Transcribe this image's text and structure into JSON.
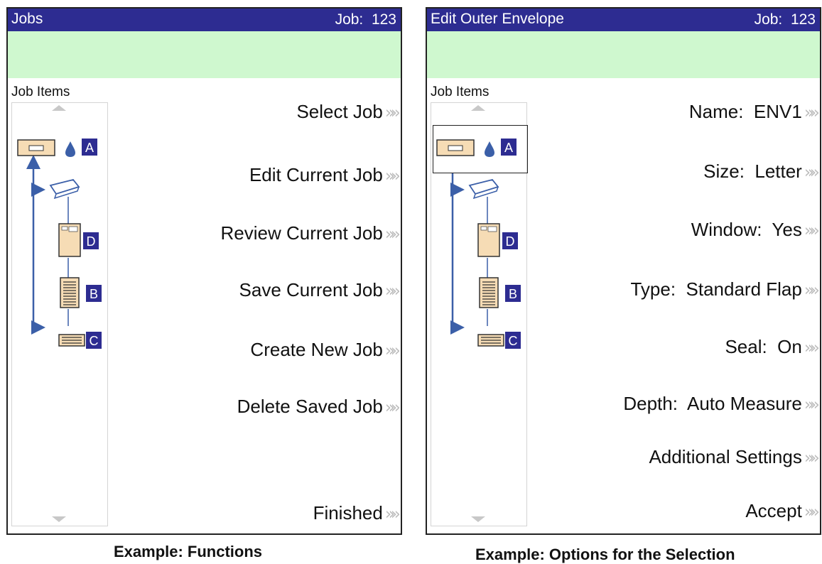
{
  "left_panel": {
    "title": "Jobs",
    "job_label": "Job:",
    "job_number": "123",
    "items_label": "Job Items",
    "tree": {
      "envelope_badge": "A",
      "enclosure_badge": "D",
      "document_badge": "B",
      "insert_badge": "C"
    },
    "menu": [
      "Select Job",
      "Edit Current Job",
      "Review Current Job",
      "Save Current Job",
      "Create New Job",
      "Delete Saved Job",
      "Finished"
    ],
    "caption": "Example: Functions"
  },
  "right_panel": {
    "title": "Edit Outer Envelope",
    "job_label": "Job:",
    "job_number": "123",
    "items_label": "Job Items",
    "tree": {
      "envelope_badge": "A",
      "enclosure_badge": "D",
      "document_badge": "B",
      "insert_badge": "C"
    },
    "menu": [
      "Name:  ENV1",
      "Size:  Letter",
      "Window:  Yes",
      "Type:  Standard Flap",
      "Seal:  On",
      "Depth:  Auto Measure",
      "Additional Settings",
      "Accept"
    ],
    "caption": "Example: Options for the Selection"
  },
  "colors": {
    "title_bar": "#2d2c91",
    "message_bar": "#cff8cf",
    "badge": "#2d2c91",
    "arrow": "#3b5fa8",
    "chevron": "#bcbcbc"
  }
}
